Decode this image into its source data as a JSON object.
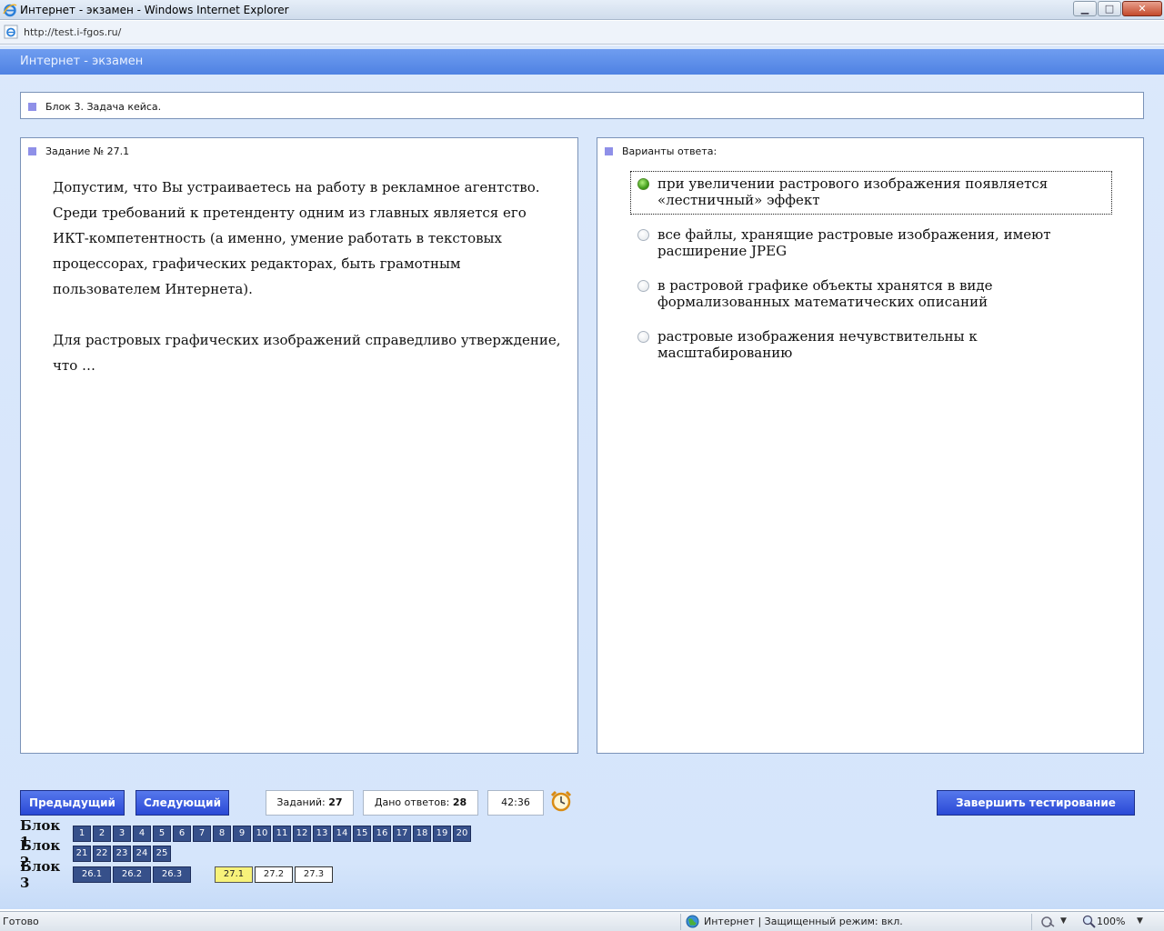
{
  "window": {
    "title": "Интернет - экзамен - Windows Internet Explorer",
    "minimize_glyph": "▁",
    "maximize_glyph": "□",
    "close_glyph": "✕"
  },
  "address": {
    "url": "http://test.i-fgos.ru/"
  },
  "app": {
    "title": "Интернет - экзамен"
  },
  "block": {
    "label": "Блок 3. Задача кейса."
  },
  "task": {
    "title": "Задание № 27.1",
    "paragraph1": "Допустим, что Вы устраиваетесь на работу в рекламное агентство. Среди требований к претенденту одним из главных является его ИКТ-компетентность (а именно, умение работать в текстовых процессорах, графических редакторах, быть грамотным пользователем Интернета).",
    "paragraph2": "Для растровых графических изображений справедливо утверждение, что …"
  },
  "answers": {
    "title": "Варианты ответа:",
    "options": [
      {
        "text": "при увеличении растрового изображения появляется «лестничный» эффект",
        "selected": true
      },
      {
        "text": "все файлы, хранящие растровые изображения, имеют расширение JPEG",
        "selected": false
      },
      {
        "text": "в растровой графике объекты хранятся в виде формализованных математических описаний",
        "selected": false
      },
      {
        "text": "растровые изображения нечувствительны к масштабированию",
        "selected": false
      }
    ]
  },
  "controls": {
    "prev_label": "Предыдущий",
    "next_label": "Следующий",
    "finish_label": "Завершить тестирование",
    "tasks_label": "Заданий:",
    "tasks_count": "27",
    "answers_label": "Дано ответов:",
    "answers_count": "28",
    "timer": "42:36"
  },
  "navigation": {
    "block1_label": "Блок 1",
    "block2_label": "Блок 2",
    "block3_label": "Блок 3",
    "block1": [
      "1",
      "2",
      "3",
      "4",
      "5",
      "6",
      "7",
      "8",
      "9",
      "10",
      "11",
      "12",
      "13",
      "14",
      "15",
      "16",
      "17",
      "18",
      "19",
      "20"
    ],
    "block2": [
      "21",
      "22",
      "23",
      "24",
      "25"
    ],
    "block3_answered": [
      "26.1",
      "26.2",
      "26.3"
    ],
    "block3_current": "27.1",
    "block3_unanswered": [
      "27.2",
      "27.3"
    ]
  },
  "status": {
    "text": "Готово",
    "zone": "Интернет | Защищенный режим: вкл.",
    "zoom": "100%",
    "dropdown_glyph": "▼"
  },
  "colors": {
    "accent": "#4f82e3",
    "button": "#2a49d6",
    "nav_cell": "#36508a",
    "current_cell": "#f7f27a",
    "selected_radio": "#3f9a19"
  }
}
